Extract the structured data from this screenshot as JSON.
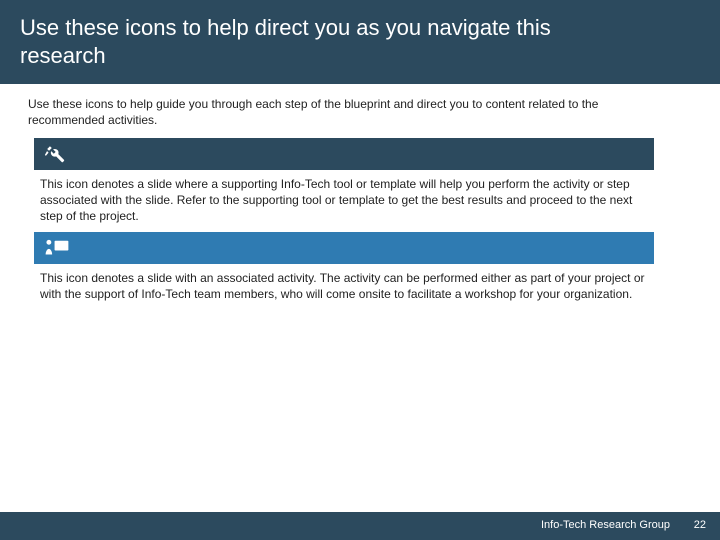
{
  "title": "Use these icons to help direct you as you navigate this research",
  "intro": "Use these icons to help guide you through each step of the blueprint and direct you to content related to the recommended activities.",
  "sections": [
    {
      "icon": "tools-icon",
      "desc": "This icon denotes a slide where a supporting Info-Tech tool or template will help you perform the activity or step associated with the slide. Refer to the supporting tool or template to get the best results and proceed to the next step of the project."
    },
    {
      "icon": "presenter-icon",
      "desc": "This icon denotes a slide with an associated activity. The activity can be performed either as part of your project or with the support of Info-Tech team members, who will come onsite to facilitate a workshop for your organization."
    }
  ],
  "footer": {
    "org": "Info-Tech Research Group",
    "page": "22"
  }
}
